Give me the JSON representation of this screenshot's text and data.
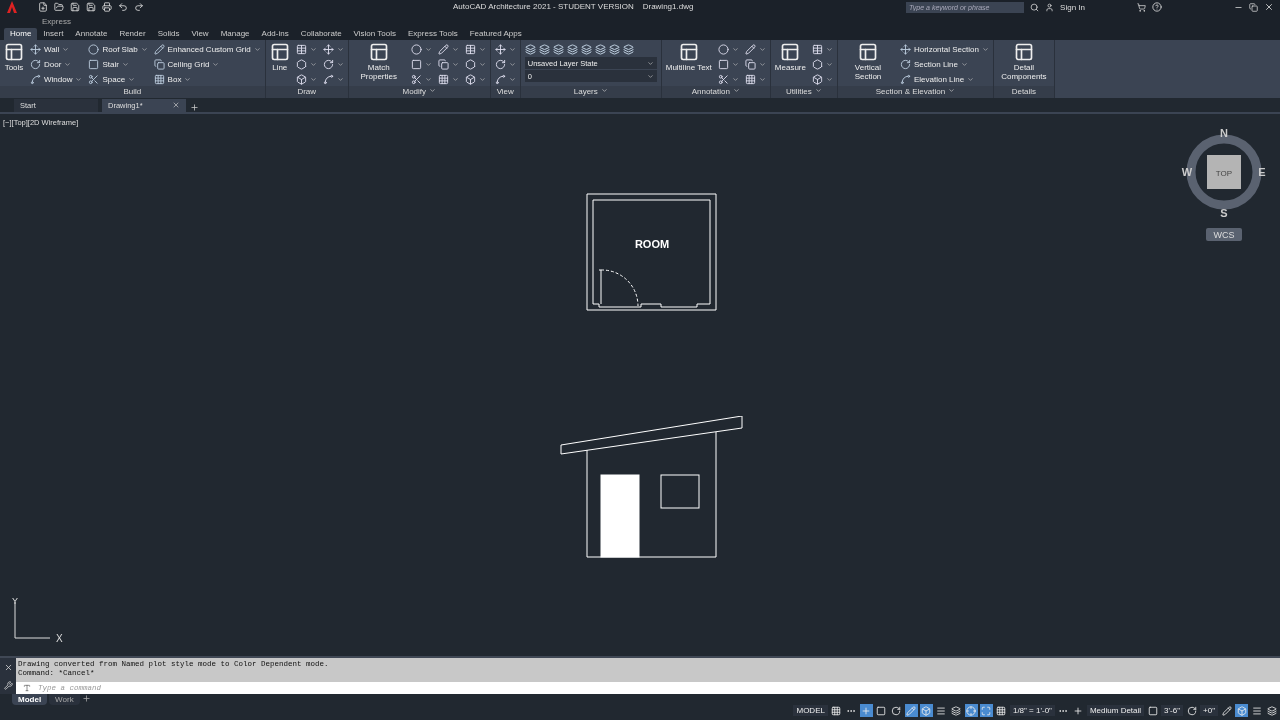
{
  "title_bar": {
    "app_title": "AutoCAD Architecture 2021 - STUDENT VERSION    Drawing1.dwg",
    "search_placeholder": "Type a keyword or phrase",
    "sign_in": "Sign In",
    "workspace": "Express"
  },
  "ribbon_tabs": [
    {
      "label": "Home",
      "selected": true
    },
    {
      "label": "Insert",
      "selected": false
    },
    {
      "label": "Annotate",
      "selected": false
    },
    {
      "label": "Render",
      "selected": false
    },
    {
      "label": "Solids",
      "selected": false
    },
    {
      "label": "View",
      "selected": false
    },
    {
      "label": "Manage",
      "selected": false
    },
    {
      "label": "Add-ins",
      "selected": false
    },
    {
      "label": "Collaborate",
      "selected": false
    },
    {
      "label": "Vision Tools",
      "selected": false
    },
    {
      "label": "Express Tools",
      "selected": false
    },
    {
      "label": "Featured Apps",
      "selected": false
    }
  ],
  "panels": [
    {
      "title": "Build",
      "menu": false,
      "large": [
        "Tools"
      ],
      "columns": [
        [
          {
            "kind": "labeled",
            "label": "Wall"
          },
          {
            "kind": "labeled",
            "label": "Door"
          },
          {
            "kind": "labeled",
            "label": "Window"
          }
        ],
        [
          {
            "kind": "labeled",
            "label": "Roof Slab"
          },
          {
            "kind": "labeled",
            "label": "Stair"
          },
          {
            "kind": "labeled",
            "label": "Space"
          }
        ],
        [
          {
            "kind": "labeled",
            "label": "Enhanced Custom Grid"
          },
          {
            "kind": "labeled",
            "label": "Ceiling Grid"
          },
          {
            "kind": "labeled",
            "label": "Box"
          }
        ]
      ]
    },
    {
      "title": "Draw",
      "menu": false,
      "large": [
        "Line"
      ],
      "columns": [
        [
          {
            "kind": "icon"
          },
          {
            "kind": "icon"
          },
          {
            "kind": "icon"
          }
        ],
        [
          {
            "kind": "icon"
          },
          {
            "kind": "icon"
          },
          {
            "kind": "icon"
          }
        ]
      ]
    },
    {
      "title": "Modify",
      "menu": true,
      "large": [
        "Match Properties"
      ],
      "columns": [
        [
          {
            "kind": "icon"
          },
          {
            "kind": "icon"
          },
          {
            "kind": "icon"
          }
        ],
        [
          {
            "kind": "icon"
          },
          {
            "kind": "icon"
          },
          {
            "kind": "icon"
          }
        ],
        [
          {
            "kind": "icon"
          },
          {
            "kind": "icon"
          },
          {
            "kind": "icon"
          }
        ]
      ]
    },
    {
      "title": "View",
      "menu": false,
      "columns": [
        [
          {
            "kind": "icon"
          },
          {
            "kind": "icon"
          },
          {
            "kind": "icon"
          }
        ]
      ]
    },
    {
      "title": "Layers",
      "menu": true,
      "columns": [
        [
          {
            "kind": "iconrow"
          },
          {
            "kind": "combo",
            "label": "Unsaved Layer State"
          },
          {
            "kind": "combo",
            "label": "0"
          }
        ]
      ]
    },
    {
      "title": "Annotation",
      "menu": true,
      "large": [
        "Multiline Text"
      ],
      "columns": [
        [
          {
            "kind": "icon"
          },
          {
            "kind": "icon"
          },
          {
            "kind": "icon"
          }
        ],
        [
          {
            "kind": "icon"
          },
          {
            "kind": "icon"
          },
          {
            "kind": "icon"
          }
        ]
      ]
    },
    {
      "title": "Utilities",
      "menu": true,
      "large": [
        "Measure"
      ],
      "columns": [
        [
          {
            "kind": "icon"
          },
          {
            "kind": "icon"
          },
          {
            "kind": "icon"
          }
        ]
      ]
    },
    {
      "title": "Section & Elevation",
      "menu": true,
      "large": [
        "Vertical Section"
      ],
      "columns": [
        [
          {
            "kind": "labeled",
            "label": "Horizontal Section"
          },
          {
            "kind": "labeled",
            "label": "Section Line"
          },
          {
            "kind": "labeled",
            "label": "Elevation Line"
          }
        ]
      ]
    },
    {
      "title": "Details",
      "menu": false,
      "large": [
        "Detail Components"
      ]
    }
  ],
  "doc_tabs": [
    {
      "label": "Start",
      "selected": false
    },
    {
      "label": "Drawing1*",
      "selected": true
    }
  ],
  "viewport_label": "[−][Top][2D Wireframe]",
  "drawing": {
    "room_label": "ROOM"
  },
  "viewcube": {
    "north": "N",
    "south": "S",
    "east": "E",
    "west": "W",
    "face": "TOP",
    "ucs": "WCS"
  },
  "ucs_icon": {
    "x": "X",
    "y": "Y"
  },
  "command": {
    "history": [
      "Drawing converted from Named plot style mode to Color Dependent mode.",
      "Command: *Cancel*"
    ],
    "placeholder": "Type a command"
  },
  "layout_tabs": [
    {
      "label": "Model",
      "selected": true
    },
    {
      "label": "Work",
      "selected": false
    }
  ],
  "status_bar": [
    {
      "kind": "text",
      "label": "MODEL"
    },
    {
      "kind": "toggle",
      "on": false
    },
    {
      "kind": "toggle",
      "on": false
    },
    {
      "kind": "toggle",
      "on": true
    },
    {
      "kind": "toggle",
      "on": false
    },
    {
      "kind": "toggle",
      "on": false
    },
    {
      "kind": "toggle",
      "on": true
    },
    {
      "kind": "toggle",
      "on": true
    },
    {
      "kind": "toggle",
      "on": false
    },
    {
      "kind": "toggle",
      "on": false
    },
    {
      "kind": "toggle",
      "on": true
    },
    {
      "kind": "toggle",
      "on": true
    },
    {
      "kind": "toggle",
      "on": false
    },
    {
      "kind": "text",
      "label": "1/8\" = 1'-0\""
    },
    {
      "kind": "toggle",
      "on": false
    },
    {
      "kind": "toggle",
      "on": false
    },
    {
      "kind": "text",
      "label": "Medium Detail"
    },
    {
      "kind": "toggle",
      "on": false
    },
    {
      "kind": "text",
      "label": "3'-6\""
    },
    {
      "kind": "toggle",
      "on": false
    },
    {
      "kind": "text",
      "label": "+0\""
    },
    {
      "kind": "toggle",
      "on": false
    },
    {
      "kind": "toggle",
      "on": true
    },
    {
      "kind": "toggle",
      "on": false
    },
    {
      "kind": "toggle",
      "on": false
    }
  ]
}
